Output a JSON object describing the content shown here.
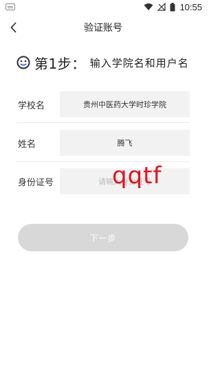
{
  "status_bar": {
    "time": "10:55"
  },
  "header": {
    "title": "验证账号"
  },
  "step": {
    "number_label": "第1步：",
    "description": "输入学院名和用户名"
  },
  "form": {
    "school": {
      "label": "学校名",
      "value": "贵州中医药大学时珍学院"
    },
    "name": {
      "label": "姓名",
      "value": "腾飞"
    },
    "id_card": {
      "label": "身份证号",
      "value": "",
      "placeholder": "请输入身份证号"
    }
  },
  "handwriting_overlay": "qqtf",
  "next_button": {
    "label": "下一步"
  },
  "colors": {
    "accent": "#2b2f3a",
    "button_disabled": "#d8d8d8",
    "field_bg": "#f2f2f2",
    "overlay": "#e0141e"
  }
}
